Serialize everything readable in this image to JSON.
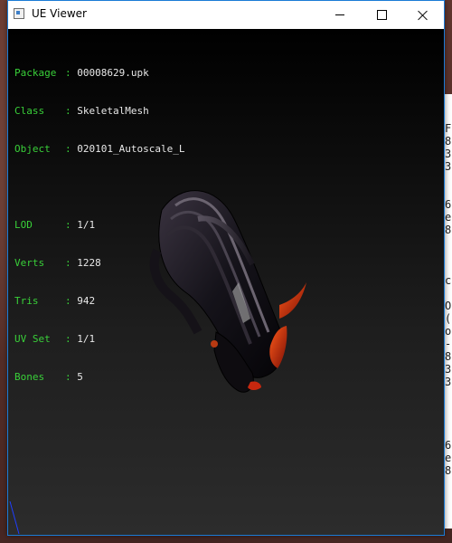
{
  "window": {
    "title": "UE Viewer"
  },
  "info": {
    "rows": [
      {
        "key": "Package",
        "value": "00008629.upk"
      },
      {
        "key": "Class",
        "value": "SkeletalMesh"
      },
      {
        "key": "Object",
        "value": "020101_Autoscale_L"
      }
    ],
    "stats": [
      {
        "key": "LOD",
        "value": "1/1"
      },
      {
        "key": "Verts",
        "value": "1228"
      },
      {
        "key": "Tris",
        "value": "942"
      },
      {
        "key": "UV Set",
        "value": "1/1"
      },
      {
        "key": "Bones",
        "value": "5"
      }
    ]
  },
  "background_app": {
    "chars": [
      "F",
      "8",
      "3",
      "3",
      "6",
      "e",
      "8",
      "c",
      "O",
      "(",
      "o",
      "-",
      "8",
      "3",
      "3",
      "6",
      "e",
      "8"
    ]
  },
  "colors": {
    "info_key": "#39d039",
    "info_value": "#e8e8e8",
    "accent_red": "#c8280f"
  }
}
